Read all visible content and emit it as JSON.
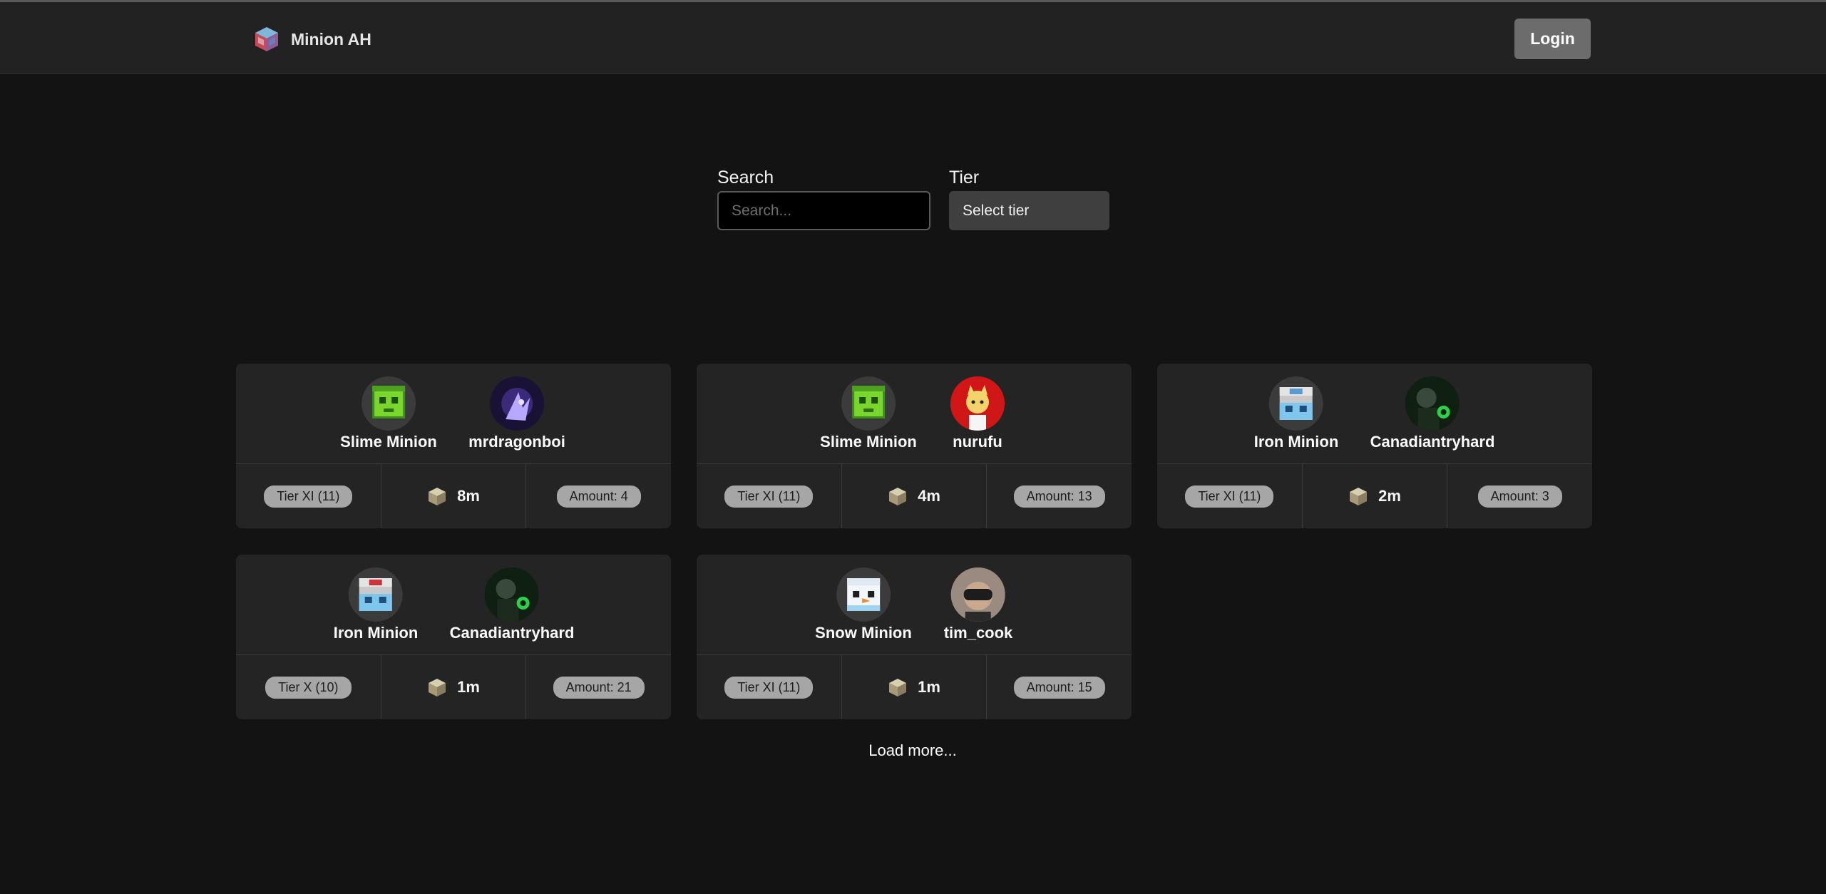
{
  "app": {
    "name": "Minion AH"
  },
  "header": {
    "login_label": "Login"
  },
  "filters": {
    "search": {
      "label": "Search",
      "placeholder": "Search...",
      "value": ""
    },
    "tier": {
      "label": "Tier",
      "selected": "Select tier"
    }
  },
  "listings": [
    {
      "minion": {
        "name": "Slime Minion",
        "icon": "slime-minion-icon"
      },
      "seller": {
        "name": "mrdragonboi",
        "avatar": "purple-dragon-avatar"
      },
      "tier": "Tier XI (11)",
      "price": "8m",
      "amount": "Amount: 4"
    },
    {
      "minion": {
        "name": "Slime Minion",
        "icon": "slime-minion-icon"
      },
      "seller": {
        "name": "nurufu",
        "avatar": "red-character-avatar"
      },
      "tier": "Tier XI (11)",
      "price": "4m",
      "amount": "Amount: 13"
    },
    {
      "minion": {
        "name": "Iron Minion",
        "icon": "iron-minion-icon"
      },
      "seller": {
        "name": "Canadiantryhard",
        "avatar": "green-lantern-avatar"
      },
      "tier": "Tier XI (11)",
      "price": "2m",
      "amount": "Amount: 3"
    },
    {
      "minion": {
        "name": "Iron Minion",
        "icon": "iron-minion-icon"
      },
      "seller": {
        "name": "Canadiantryhard",
        "avatar": "green-lantern-avatar"
      },
      "tier": "Tier X (10)",
      "price": "1m",
      "amount": "Amount: 21"
    },
    {
      "minion": {
        "name": "Snow Minion",
        "icon": "snow-minion-icon"
      },
      "seller": {
        "name": "tim_cook",
        "avatar": "vr-headset-avatar"
      },
      "tier": "Tier XI (11)",
      "price": "1m",
      "amount": "Amount: 15"
    }
  ],
  "load_more_label": "Load more..."
}
